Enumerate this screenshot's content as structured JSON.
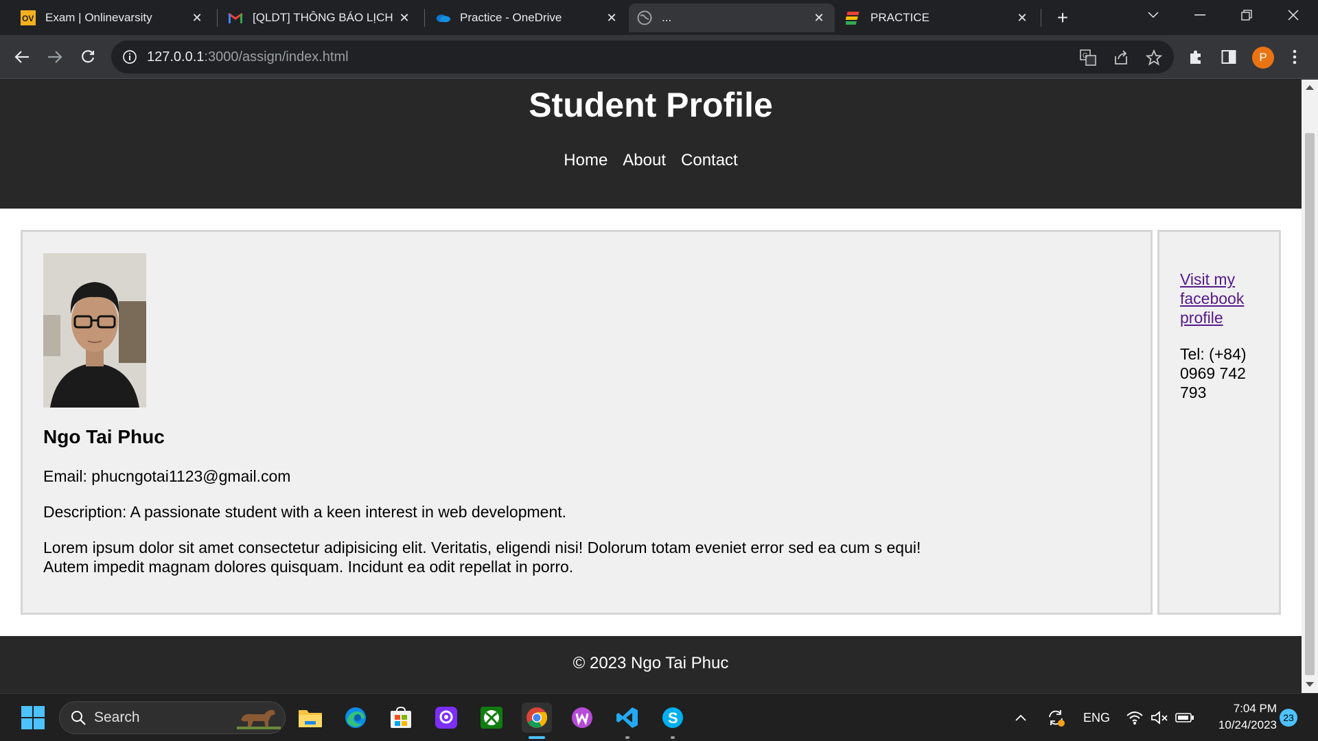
{
  "browser": {
    "tabs": [
      {
        "title": "Exam | Onlinevarsity",
        "icon": "onlinevarsity-icon"
      },
      {
        "title": "[QLDT] THÔNG BÁO LỊCH",
        "icon": "gmail-icon"
      },
      {
        "title": "Practice - OneDrive",
        "icon": "onedrive-icon"
      },
      {
        "title": "...",
        "icon": "globe-icon",
        "active": true
      },
      {
        "title": "PRACTICE",
        "icon": "practice-icon"
      }
    ],
    "url_host": "127.0.0.1",
    "url_path": ":3000/assign/index.html",
    "profile_initial": "P"
  },
  "page": {
    "title": "Student Profile",
    "nav": [
      "Home",
      "About",
      "Contact"
    ],
    "student": {
      "name": "Ngo Tai Phuc",
      "email": "Email: phucngotai1123@gmail.com",
      "description": "Description: A passionate student with a keen interest in web development.",
      "lorem_line1": "Lorem ipsum dolor sit amet consectetur adipisicing elit. Veritatis, eligendi nisi! Dolorum totam eveniet error sed ea cum s equi!",
      "lorem_line2": "Autem impedit magnam dolores quisquam. Incidunt ea odit repellat in porro."
    },
    "sidebar": {
      "facebook_link": "Visit my facebook profile",
      "tel": "Tel: (+84) 0969 742 793"
    },
    "footer": "© 2023 Ngo Tai Phuc"
  },
  "taskbar": {
    "search_label": "Search",
    "language": "ENG",
    "time": "7:04 PM",
    "date": "10/24/2023",
    "notification_count": "23"
  },
  "colors": {
    "header_bg": "#282828",
    "card_bg": "#f0f0f0",
    "link_visited": "#551a8b",
    "browser_bg": "#202124",
    "profile_accent": "#ea7413",
    "taskbar_accent": "#4cc2ff"
  }
}
